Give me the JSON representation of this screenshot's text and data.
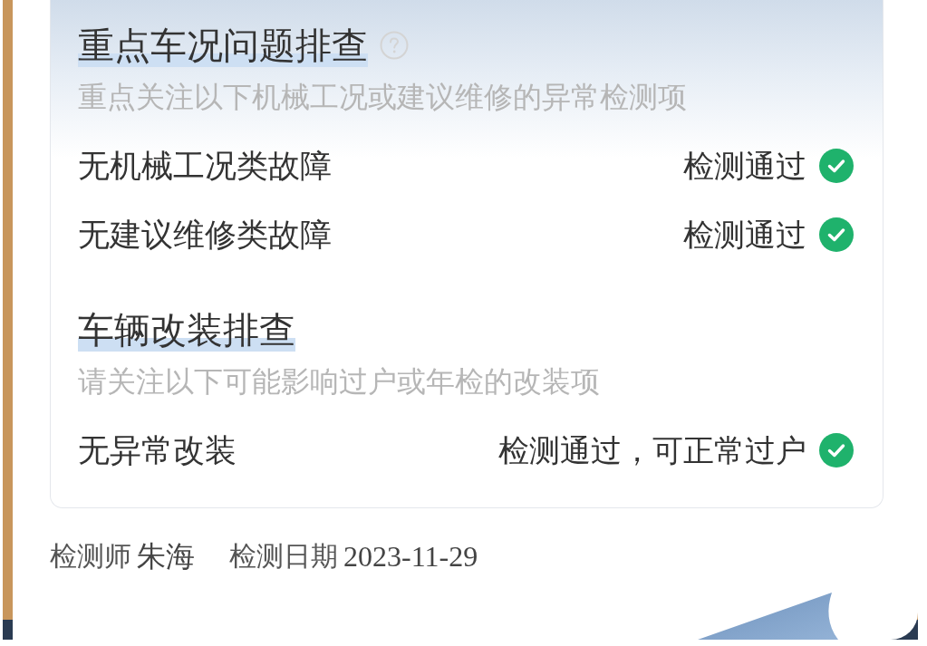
{
  "sections": [
    {
      "title": "重点车况问题排查",
      "has_help": true,
      "subtitle": "重点关注以下机械工况或建议维修的异常检测项",
      "items": [
        {
          "label": "无机械工况类故障",
          "status": "检测通过",
          "passed": true
        },
        {
          "label": "无建议维修类故障",
          "status": "检测通过",
          "passed": true
        }
      ]
    },
    {
      "title": "车辆改装排查",
      "has_help": false,
      "subtitle": "请关注以下可能影响过户或年检的改装项",
      "items": [
        {
          "label": "无异常改装",
          "status": "检测通过，可正常过户",
          "passed": true
        }
      ]
    }
  ],
  "inspector": {
    "label": "检测师",
    "name": "朱海"
  },
  "inspection_date": {
    "label": "检测日期",
    "value": "2023-11-29"
  }
}
